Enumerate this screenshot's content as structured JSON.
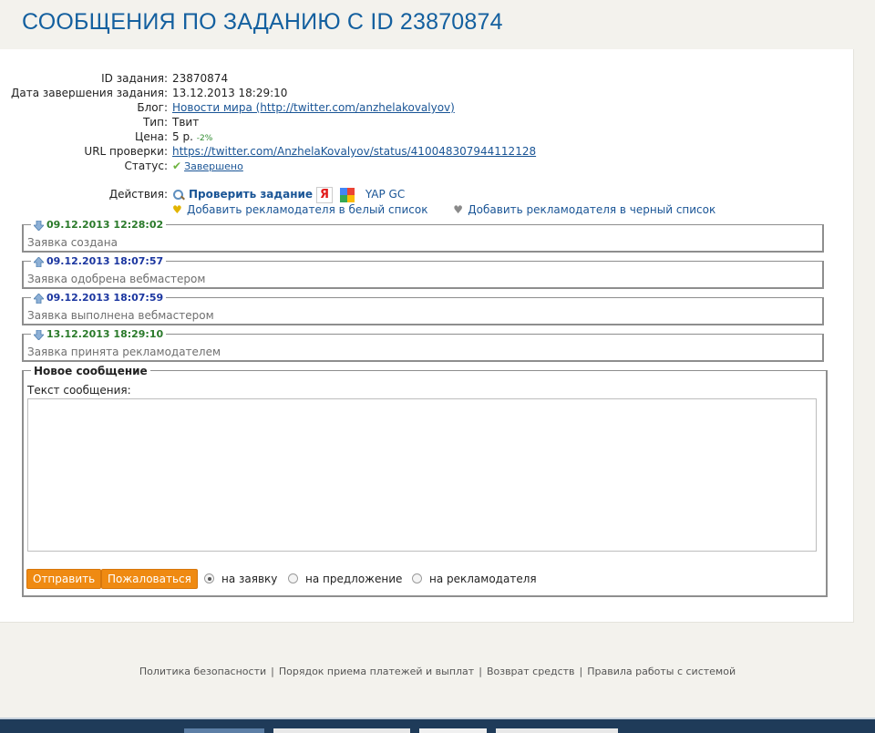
{
  "page": {
    "title": "СООБЩЕНИЯ ПО ЗАДАНИЮ С ID 23870874"
  },
  "info": {
    "task_id_label": "ID задания:",
    "task_id": "23870874",
    "end_date_label": "Дата завершения задания:",
    "end_date": "13.12.2013 18:29:10",
    "blog_label": "Блог:",
    "blog": "Новости мира (http://twitter.com/anzhelakovalyov)",
    "type_label": "Тип:",
    "type": "Твит",
    "price_label": "Цена:",
    "price": "5 р.",
    "price_change": "-2%",
    "url_label": "URL проверки:",
    "url": "https://twitter.com/AnzhelaKovalyov/status/410048307944112128",
    "status_label": "Статус:",
    "status": "Завершено"
  },
  "actions": {
    "label": "Действия:",
    "check_task": "Проверить задание",
    "yandex_letter": "Я",
    "yap_gc": "YAP GC",
    "whitelist": "Добавить рекламодателя в белый список",
    "blacklist": "Добавить рекламодателя в черный список"
  },
  "history": [
    {
      "timestamp": "09.12.2013 12:28:02",
      "text": "Заявка создана",
      "direction": "down",
      "color": "#2a7a2a"
    },
    {
      "timestamp": "09.12.2013 18:07:57",
      "text": "Заявка одобрена вебмастером",
      "direction": "up",
      "color": "#1b36a0"
    },
    {
      "timestamp": "09.12.2013 18:07:59",
      "text": "Заявка выполнена вебмастером",
      "direction": "up",
      "color": "#1b36a0"
    },
    {
      "timestamp": "13.12.2013 18:29:10",
      "text": "Заявка принята рекламодателем",
      "direction": "down",
      "color": "#2a7a2a"
    }
  ],
  "new_message": {
    "legend": "Новое сообщение",
    "text_label": "Текст сообщения:",
    "textarea_value": "",
    "send_button": "Отправить",
    "complain_button": "Пожаловаться",
    "radio_options": [
      "на заявку",
      "на предложение",
      "на рекламодателя"
    ],
    "radio_selected": "на заявку"
  },
  "footer": {
    "links": [
      "Политика безопасности",
      "Порядок приема платежей и выплат",
      "Возврат средств",
      "Правила работы с системой"
    ]
  },
  "colors": {
    "accent_blue": "#14609f",
    "button_orange": "#ef8a12",
    "bottom_bar": "#1f3b59"
  }
}
